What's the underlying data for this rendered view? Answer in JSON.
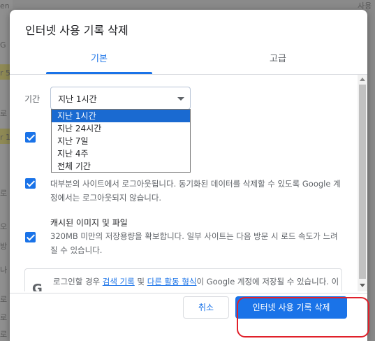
{
  "background": {
    "fragments": [
      "로",
      "로",
      "오",
      "r 5",
      "G",
      "en",
      "r 1",
      "나",
      "로",
      "로",
      "로",
      "방",
      "사용"
    ]
  },
  "dialog": {
    "title": "인터넷 사용 기록 삭제",
    "tabs": [
      {
        "label": "기본",
        "active": true
      },
      {
        "label": "고급",
        "active": false
      }
    ],
    "time_range": {
      "label": "기간",
      "selected": "지난 1시간",
      "options": [
        "지난 1시간",
        "지난 24시간",
        "지난 7일",
        "지난 4주",
        "전체 기간"
      ]
    },
    "items": [
      {
        "checked": true,
        "title": "",
        "description": ""
      },
      {
        "checked": true,
        "title": "",
        "description": "대부분의 사이트에서 로그아웃됩니다. 동기화된 데이터를 삭제할 수 있도록 Google 계정에서는 로그아웃되지 않습니다."
      },
      {
        "checked": true,
        "title": "캐시된 이미지 및 파일",
        "description": "320MB 미만의 저장용량을 확보합니다. 일부 사이트는 다음 방문 시 로드 속도가 느려질 수 있습니다."
      }
    ],
    "info": {
      "icon": "G",
      "text_before": "로그인할 경우 ",
      "link1": "검색 기록",
      "text_mid": " 및 ",
      "link2": "다른 활동 형식",
      "text_after": "이 Google 계정에 저장될 수 있습니다. 이러한 데이터는 언제든지 삭제할 수 있습니다."
    },
    "buttons": {
      "cancel": "취소",
      "delete": "인터넷 사용 기록 삭제"
    }
  },
  "colors": {
    "accent": "#1a73e8",
    "highlight": "#e0202a"
  }
}
